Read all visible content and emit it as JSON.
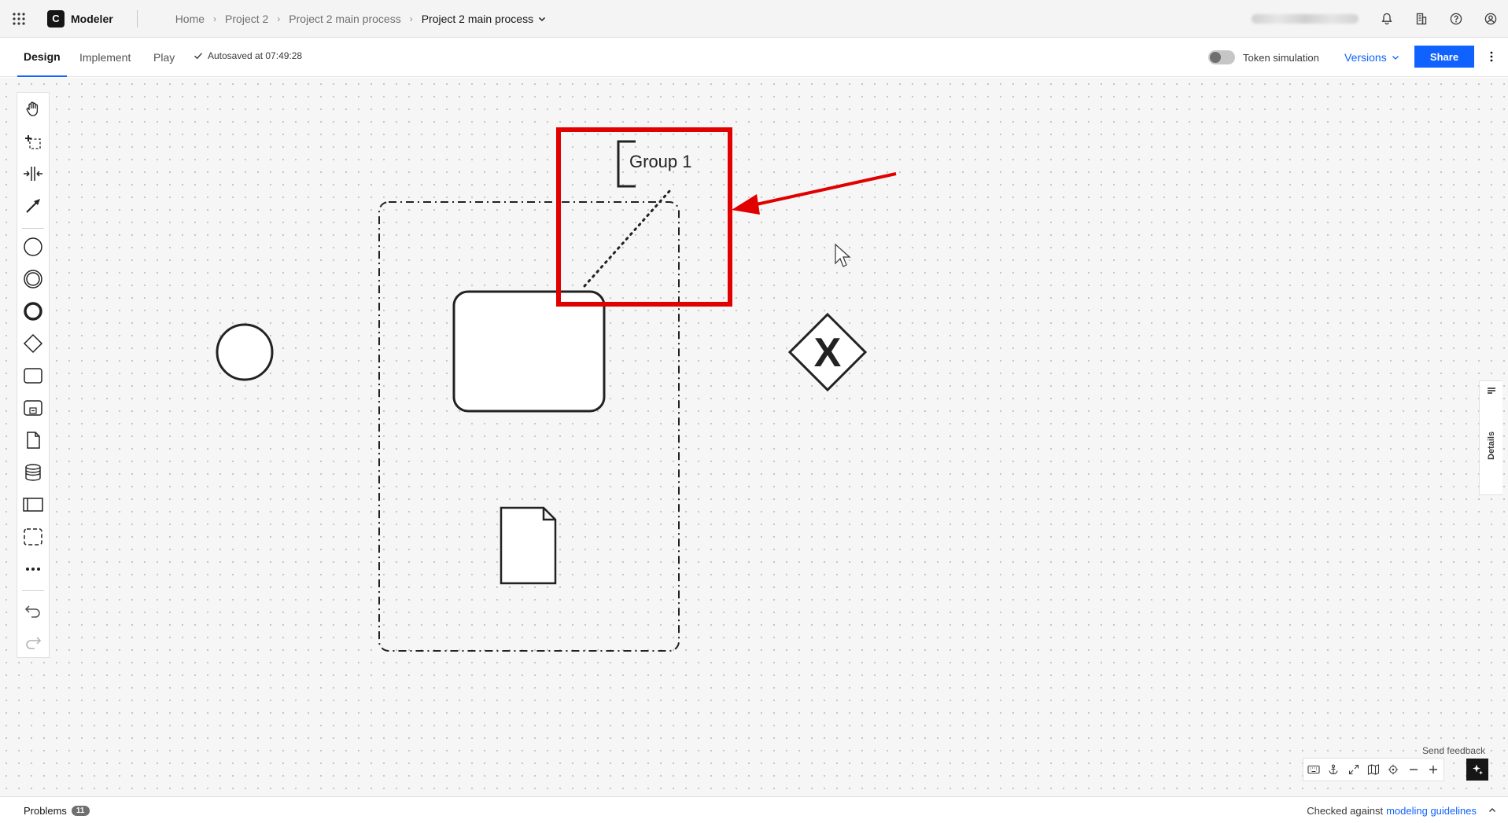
{
  "header": {
    "app_name": "Modeler",
    "logo_letter": "C",
    "breadcrumb": [
      "Home",
      "Project 2",
      "Project 2 main process"
    ],
    "current": "Project 2 main process",
    "icons": [
      "apps-grid-icon",
      "bell-icon",
      "building-icon",
      "help-icon",
      "user-avatar-icon"
    ]
  },
  "toolbar": {
    "tabs": [
      "Design",
      "Implement",
      "Play"
    ],
    "active_tab": "Design",
    "autosave": "Autosaved at 07:49:28",
    "token_simulation": "Token simulation",
    "token_simulation_on": false,
    "versions": "Versions",
    "share": "Share"
  },
  "palette": {
    "tools": [
      "hand-tool",
      "lasso-tool",
      "space-tool",
      "connect-tool",
      "start-event",
      "intermediate-event",
      "end-event",
      "gateway",
      "task",
      "subprocess",
      "data-object",
      "data-store",
      "pool",
      "group",
      "more"
    ],
    "undo": "undo-icon",
    "redo": "redo-icon"
  },
  "diagram": {
    "group_label": "Group 1",
    "gateway_marker": "X",
    "highlight_color": "#e00000",
    "accent": "#0f62fe"
  },
  "details": {
    "label": "Details"
  },
  "bottom": {
    "feedback": "Send feedback"
  },
  "footer": {
    "problems": "Problems",
    "problems_count": "11",
    "checked_prefix": "Checked against",
    "checked_link": "modeling guidelines"
  }
}
